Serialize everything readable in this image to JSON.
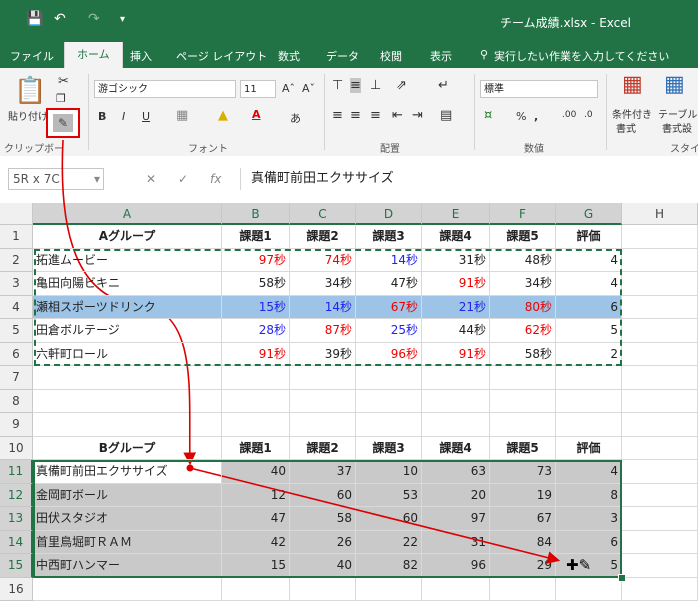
{
  "app": {
    "title": "チーム成績.xlsx - Excel",
    "quick_access": [
      "save-icon",
      "undo-icon",
      "redo-icon",
      "customize-icon"
    ]
  },
  "tabs": [
    "ファイル",
    "ホーム",
    "挿入",
    "ページ レイアウト",
    "数式",
    "データ",
    "校閲",
    "表示"
  ],
  "active_tab": "ホーム",
  "tell_me": "実行したい作業を入力してください",
  "ribbon": {
    "paste_label": "貼り付け",
    "font_name": "游ゴシック",
    "font_size": "11",
    "number_format": "標準",
    "conditional_label_1": "条件付き",
    "conditional_label_2": "書式",
    "table_label_1": "テーブル",
    "table_label_2": "書式設",
    "groups": [
      "クリップボー",
      "フォント",
      "配置",
      "数値",
      "スタイ"
    ]
  },
  "formula_bar": {
    "name_box": "5R x 7C",
    "formula": "真備町前田エクササイズ"
  },
  "colors": {
    "excel_green": "#217346",
    "selection_blue": "#9dc3e6",
    "paste_gray": "#c9c9c9",
    "red_text": "#ee0000",
    "blue_text": "#2222ee",
    "arrow": "#dd0000"
  },
  "columns": [
    "A",
    "B",
    "C",
    "D",
    "E",
    "F",
    "G",
    "H"
  ],
  "rows": [
    {
      "n": "1",
      "cells": [
        {
          "t": "Aグループ",
          "c": "bold"
        },
        {
          "t": "課題1",
          "c": "bold"
        },
        {
          "t": "課題2",
          "c": "bold"
        },
        {
          "t": "課題3",
          "c": "bold"
        },
        {
          "t": "課題4",
          "c": "bold"
        },
        {
          "t": "課題5",
          "c": "bold"
        },
        {
          "t": "評価",
          "c": "bold"
        },
        {
          "t": "",
          "c": ""
        }
      ]
    },
    {
      "n": "2",
      "cells": [
        {
          "t": "拓進ムービー",
          "c": ""
        },
        {
          "t": "97秒",
          "c": "red"
        },
        {
          "t": "74秒",
          "c": "red"
        },
        {
          "t": "14秒",
          "c": "blue"
        },
        {
          "t": "31秒",
          "c": ""
        },
        {
          "t": "48秒",
          "c": ""
        },
        {
          "t": "4",
          "c": ""
        },
        {
          "t": "",
          "c": ""
        }
      ]
    },
    {
      "n": "3",
      "cells": [
        {
          "t": "亀田向陽ビキニ",
          "c": ""
        },
        {
          "t": "58秒",
          "c": ""
        },
        {
          "t": "34秒",
          "c": ""
        },
        {
          "t": "47秒",
          "c": ""
        },
        {
          "t": "91秒",
          "c": "red"
        },
        {
          "t": "34秒",
          "c": ""
        },
        {
          "t": "4",
          "c": ""
        },
        {
          "t": "",
          "c": ""
        }
      ]
    },
    {
      "n": "4",
      "cells": [
        {
          "t": "瀬相スポーツドリンク",
          "c": ""
        },
        {
          "t": "15秒",
          "c": "blue"
        },
        {
          "t": "14秒",
          "c": "blue"
        },
        {
          "t": "67秒",
          "c": "red"
        },
        {
          "t": "21秒",
          "c": "blue"
        },
        {
          "t": "80秒",
          "c": "red"
        },
        {
          "t": "6",
          "c": ""
        },
        {
          "t": "",
          "c": ""
        }
      ],
      "highlight": true
    },
    {
      "n": "5",
      "cells": [
        {
          "t": "田倉ボルテージ",
          "c": ""
        },
        {
          "t": "28秒",
          "c": "blue"
        },
        {
          "t": "87秒",
          "c": "red"
        },
        {
          "t": "25秒",
          "c": "blue"
        },
        {
          "t": "44秒",
          "c": ""
        },
        {
          "t": "62秒",
          "c": "red"
        },
        {
          "t": "5",
          "c": ""
        },
        {
          "t": "",
          "c": ""
        }
      ]
    },
    {
      "n": "6",
      "cells": [
        {
          "t": "六軒町ロール",
          "c": ""
        },
        {
          "t": "91秒",
          "c": "red"
        },
        {
          "t": "39秒",
          "c": ""
        },
        {
          "t": "96秒",
          "c": "red"
        },
        {
          "t": "91秒",
          "c": "red"
        },
        {
          "t": "58秒",
          "c": ""
        },
        {
          "t": "2",
          "c": ""
        },
        {
          "t": "",
          "c": ""
        }
      ]
    },
    {
      "n": "7",
      "cells": []
    },
    {
      "n": "8",
      "cells": []
    },
    {
      "n": "9",
      "cells": []
    },
    {
      "n": "10",
      "cells": [
        {
          "t": "Bグループ",
          "c": "bold"
        },
        {
          "t": "課題1",
          "c": "bold"
        },
        {
          "t": "課題2",
          "c": "bold"
        },
        {
          "t": "課題3",
          "c": "bold"
        },
        {
          "t": "課題4",
          "c": "bold"
        },
        {
          "t": "課題5",
          "c": "bold"
        },
        {
          "t": "評価",
          "c": "bold"
        },
        {
          "t": "",
          "c": ""
        }
      ]
    },
    {
      "n": "11",
      "cells": [
        {
          "t": "真備町前田エクササイズ",
          "c": ""
        },
        {
          "t": "40",
          "c": "gray"
        },
        {
          "t": "37",
          "c": "gray"
        },
        {
          "t": "10",
          "c": "gray"
        },
        {
          "t": "63",
          "c": "gray"
        },
        {
          "t": "73",
          "c": "gray"
        },
        {
          "t": "4",
          "c": "gray"
        },
        {
          "t": "",
          "c": ""
        }
      ],
      "sel": true
    },
    {
      "n": "12",
      "cells": [
        {
          "t": "金岡町ボール",
          "c": "gray"
        },
        {
          "t": "12",
          "c": "gray"
        },
        {
          "t": "60",
          "c": "gray"
        },
        {
          "t": "53",
          "c": "gray"
        },
        {
          "t": "20",
          "c": "gray"
        },
        {
          "t": "19",
          "c": "gray"
        },
        {
          "t": "8",
          "c": "gray"
        },
        {
          "t": "",
          "c": ""
        }
      ],
      "sel": true
    },
    {
      "n": "13",
      "cells": [
        {
          "t": "田伏スタジオ",
          "c": "gray"
        },
        {
          "t": "47",
          "c": "gray"
        },
        {
          "t": "58",
          "c": "gray"
        },
        {
          "t": "60",
          "c": "gray"
        },
        {
          "t": "97",
          "c": "gray"
        },
        {
          "t": "67",
          "c": "gray"
        },
        {
          "t": "3",
          "c": "gray"
        },
        {
          "t": "",
          "c": ""
        }
      ],
      "sel": true
    },
    {
      "n": "14",
      "cells": [
        {
          "t": "首里鳥堀町ＲＡＭ",
          "c": "gray"
        },
        {
          "t": "42",
          "c": "gray"
        },
        {
          "t": "26",
          "c": "gray"
        },
        {
          "t": "22",
          "c": "gray"
        },
        {
          "t": "31",
          "c": "gray"
        },
        {
          "t": "84",
          "c": "gray"
        },
        {
          "t": "6",
          "c": "gray"
        },
        {
          "t": "",
          "c": ""
        }
      ],
      "sel": true
    },
    {
      "n": "15",
      "cells": [
        {
          "t": "中西町ハンマー",
          "c": "gray"
        },
        {
          "t": "15",
          "c": "gray"
        },
        {
          "t": "40",
          "c": "gray"
        },
        {
          "t": "82",
          "c": "gray"
        },
        {
          "t": "96",
          "c": "gray"
        },
        {
          "t": "29",
          "c": "gray"
        },
        {
          "t": "5",
          "c": "gray"
        },
        {
          "t": "",
          "c": ""
        }
      ],
      "sel": true
    },
    {
      "n": "16",
      "cells": []
    }
  ]
}
